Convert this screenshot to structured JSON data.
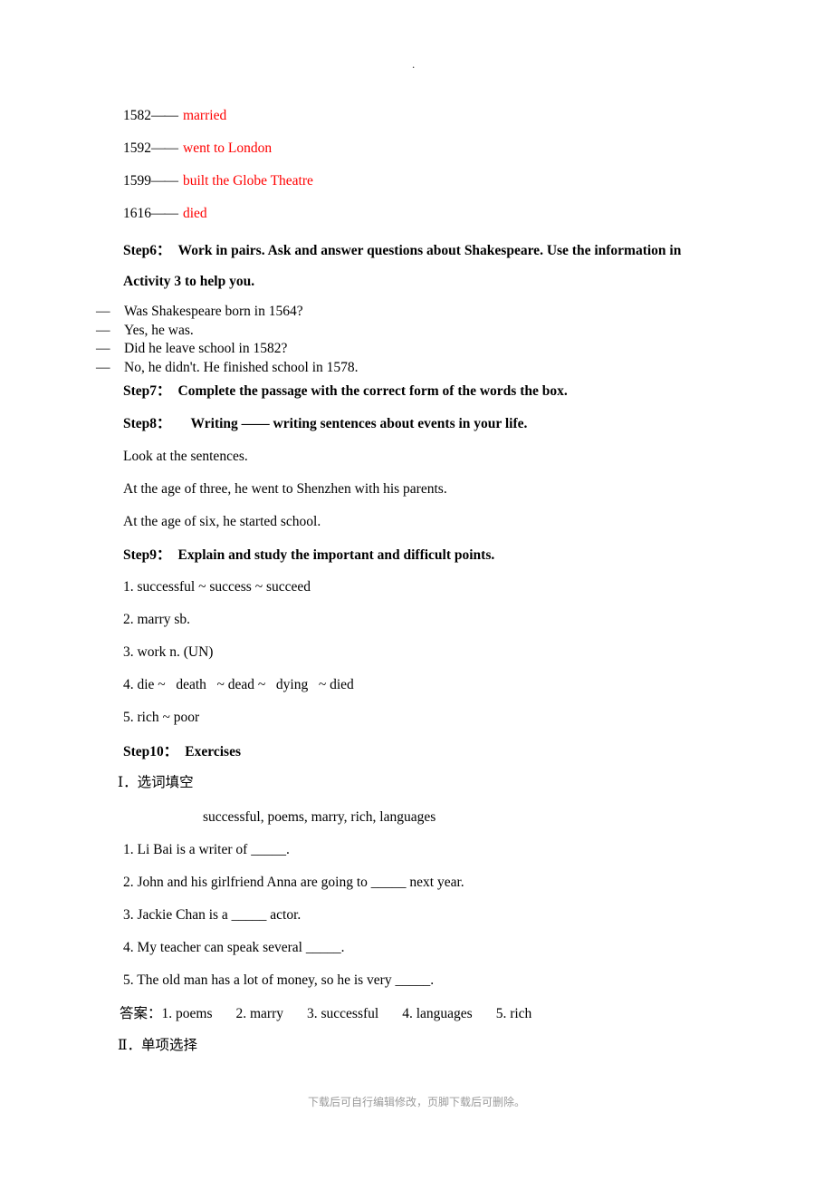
{
  "document": {
    "top_mark": ".",
    "footer_note": "下载后可自行编辑修改，页脚下载后可删除。"
  },
  "timeline": {
    "dash": "——",
    "rows": [
      {
        "year": "1582",
        "event": "married"
      },
      {
        "year": "1592",
        "event": "went to London"
      },
      {
        "year": "1599",
        "event": "built the Globe Theatre"
      },
      {
        "year": "1616",
        "event": "died"
      }
    ],
    "event_color": "#ff0000"
  },
  "steps": {
    "step6": {
      "label": "Step6：",
      "line1": "Work in pairs. Ask and answer questions about Shakespeare. Use the information in",
      "line2": "Activity 3 to help you."
    },
    "step7": {
      "label": "Step7：",
      "text": "Complete the passage with the correct form of the words the box."
    },
    "step8": {
      "label": "Step8：",
      "text": "Writing —— writing sentences about events in your life."
    },
    "step9": {
      "label": "Step9：",
      "text": "Explain and study the important and difficult points."
    },
    "step10": {
      "label": "Step10：",
      "text": "Exercises"
    }
  },
  "dialogue": {
    "bullet": "—",
    "lines": [
      "Was Shakespeare born in 1564?",
      "Yes, he was.",
      "Did he leave school in 1582?",
      "No, he didn't. He finished school in 1578."
    ]
  },
  "writing_examples": {
    "lead": "Look at the sentences.",
    "sentences": [
      "At the age of three, he went to Shenzhen with his parents.",
      "At the age of six, he started school."
    ]
  },
  "language_points": [
    "1. successful ~ success ~ succeed",
    "2. marry sb.",
    "3. work n. (UN)",
    "4. die ~   death   ~ dead ~   dying   ~ died",
    "5. rich ~ poor"
  ],
  "exercises": {
    "section1_title": "Ⅰ．选词填空",
    "word_box": "successful, poems, marry, rich, languages",
    "questions": [
      "1. Li Bai is a writer of _____.",
      "2. John and his girlfriend Anna are going to _____ next year.",
      "3. Jackie Chan is a _____ actor.",
      "4. My teacher can speak several _____.",
      "5. The old man has a lot of money, so he is very _____."
    ],
    "answers_label": "答案：",
    "answers": [
      "1. poems",
      "2. marry",
      "3. successful",
      "4. languages",
      "5. rich"
    ],
    "section2_title": "Ⅱ．单项选择"
  }
}
